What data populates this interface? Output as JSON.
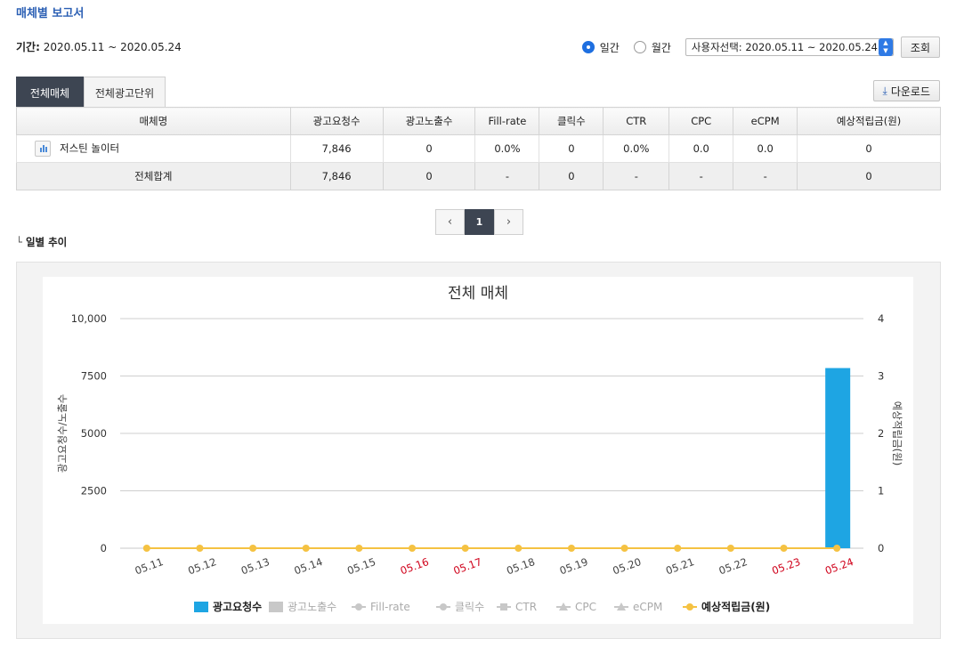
{
  "header": {
    "title": "매체별 보고서"
  },
  "period": {
    "label": "기간:",
    "value": "2020.05.11 ~ 2020.05.24"
  },
  "controls": {
    "daily_label": "일간",
    "monthly_label": "월간",
    "date_select_value": "사용자선택: 2020.05.11 ~ 2020.05.24",
    "search_label": "조회"
  },
  "tabs": [
    {
      "label": "전체매체",
      "active": true
    },
    {
      "label": "전체광고단위",
      "active": false
    }
  ],
  "download_label": "다운로드",
  "table": {
    "headers": [
      "매체명",
      "광고요청수",
      "광고노출수",
      "Fill-rate",
      "클릭수",
      "CTR",
      "CPC",
      "eCPM",
      "예상적립금(원)"
    ],
    "rows": [
      [
        "저스틴 놀이터",
        "7,846",
        "0",
        "0.0%",
        "0",
        "0.0%",
        "0.0",
        "0.0",
        "0"
      ]
    ],
    "total": [
      "전체합계",
      "7,846",
      "0",
      "-",
      "0",
      "-",
      "-",
      "-",
      "0"
    ]
  },
  "pagination": {
    "prev": "‹",
    "current": "1",
    "next": "›"
  },
  "section_label": "일별 추이",
  "colors": {
    "accent": "#2b5fb4",
    "bar": "#1ea5e3",
    "line": "#f5c242",
    "weekend": "#d0021b"
  },
  "chart_data": {
    "type": "bar",
    "title": "전체 매체",
    "ylabel": "광고요청수/노출수",
    "y2label": "예상적립금(원)",
    "categories": [
      "05.11",
      "05.12",
      "05.13",
      "05.14",
      "05.15",
      "05.16",
      "05.17",
      "05.18",
      "05.19",
      "05.20",
      "05.21",
      "05.22",
      "05.23",
      "05.24"
    ],
    "weekend_categories": [
      "05.16",
      "05.17",
      "05.23",
      "05.24"
    ],
    "ylim": [
      0,
      10000
    ],
    "y_ticks": [
      "0",
      "2500",
      "5000",
      "7500",
      "10,000"
    ],
    "y2lim": [
      0,
      4
    ],
    "y2_ticks": [
      "0",
      "1",
      "2",
      "3",
      "4"
    ],
    "grid": true,
    "legend_placement": "bottom",
    "series": [
      {
        "name": "광고요청수",
        "type": "bar",
        "axis": "left",
        "values": [
          0,
          0,
          0,
          0,
          0,
          0,
          0,
          0,
          0,
          0,
          0,
          0,
          0,
          7846
        ],
        "active": true,
        "color": "#1ea5e3"
      },
      {
        "name": "광고노출수",
        "type": "bar",
        "axis": "left",
        "values": [
          0,
          0,
          0,
          0,
          0,
          0,
          0,
          0,
          0,
          0,
          0,
          0,
          0,
          0
        ],
        "active": false,
        "color": "#c8c8c8"
      },
      {
        "name": "Fill-rate",
        "type": "line",
        "active": false,
        "color": "#c8c8c8"
      },
      {
        "name": "클릭수",
        "type": "line",
        "active": false,
        "color": "#c8c8c8"
      },
      {
        "name": "CTR",
        "type": "line",
        "active": false,
        "color": "#c8c8c8"
      },
      {
        "name": "CPC",
        "type": "line",
        "active": false,
        "color": "#c8c8c8"
      },
      {
        "name": "eCPM",
        "type": "line",
        "active": false,
        "color": "#c8c8c8"
      },
      {
        "name": "예상적립금(원)",
        "type": "line",
        "axis": "right",
        "values": [
          0,
          0,
          0,
          0,
          0,
          0,
          0,
          0,
          0,
          0,
          0,
          0,
          0,
          0
        ],
        "active": true,
        "color": "#f5c242"
      }
    ]
  }
}
